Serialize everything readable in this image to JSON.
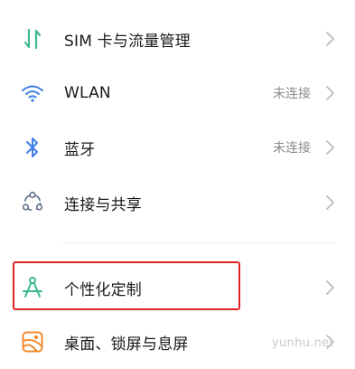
{
  "settings": {
    "items": [
      {
        "label": "SIM 卡与流量管理",
        "status": "",
        "icon": "sim-data-arrows-icon"
      },
      {
        "label": "WLAN",
        "status": "未连接",
        "icon": "wifi-icon"
      },
      {
        "label": "蓝牙",
        "status": "未连接",
        "icon": "bluetooth-icon"
      },
      {
        "label": "连接与共享",
        "status": "",
        "icon": "connection-sharing-icon"
      },
      {
        "label": "个性化定制",
        "status": "",
        "icon": "personalization-icon"
      },
      {
        "label": "桌面、锁屏与息屏",
        "status": "",
        "icon": "wallpaper-icon"
      }
    ]
  },
  "watermark": "yunhu.net",
  "colors": {
    "green_icon": "#3cb98a",
    "blue_icon": "#3f7ee8",
    "orange_icon": "#f28b2c",
    "highlight": "#e02424"
  }
}
